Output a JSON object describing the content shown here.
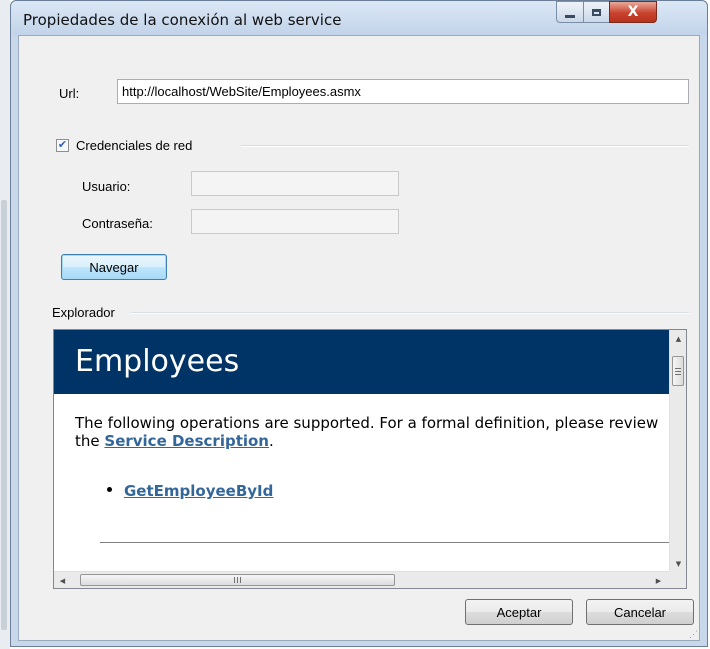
{
  "window": {
    "title": "Propiedades de la conexión al web service",
    "close_glyph": "X"
  },
  "form": {
    "url_label": "Url:",
    "url_value": "http://localhost/WebSite/Employees.asmx",
    "credentials_label": "Credenciales de red",
    "credentials_checked": true,
    "user_label": "Usuario:",
    "user_value": "",
    "password_label": "Contraseña:",
    "password_value": "",
    "navigate_button": "Navegar",
    "explorer_label": "Explorador"
  },
  "browser": {
    "page_title": "Employees",
    "intro_text": "The following operations are supported. For a formal definition, please review the ",
    "service_description_link": "Service Description",
    "intro_end": ".",
    "operations": [
      "GetEmployeeById"
    ],
    "hscroll_grip": "III"
  },
  "footer": {
    "ok_button": "Aceptar",
    "cancel_button": "Cancelar"
  },
  "icons": {
    "minimize": "minimize-icon",
    "maximize": "maximize-icon",
    "close": "close-icon",
    "check": "check-icon",
    "scroll_up": "scroll-up-icon",
    "scroll_down": "scroll-down-icon",
    "scroll_left": "scroll-left-icon",
    "scroll_right": "scroll-right-icon"
  },
  "colors": {
    "web_header_bg": "#003366",
    "link": "#336699",
    "close_button": "#c8432e"
  }
}
